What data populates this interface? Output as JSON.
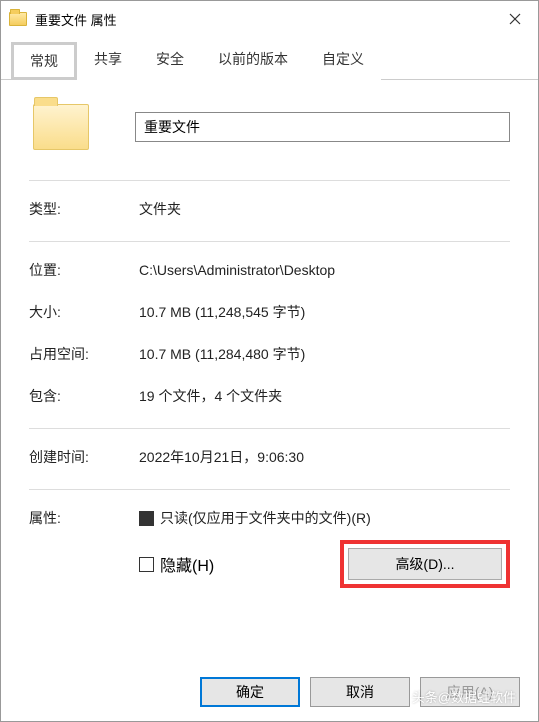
{
  "title": "重要文件 属性",
  "tabs": {
    "general": "常规",
    "sharing": "共享",
    "security": "安全",
    "previous": "以前的版本",
    "customize": "自定义"
  },
  "folder_name": "重要文件",
  "fields": {
    "type_label": "类型:",
    "type_value": "文件夹",
    "location_label": "位置:",
    "location_value": "C:\\Users\\Administrator\\Desktop",
    "size_label": "大小:",
    "size_value": "10.7 MB (11,248,545 字节)",
    "disk_label": "占用空间:",
    "disk_value": "10.7 MB (11,284,480 字节)",
    "contains_label": "包含:",
    "contains_value": "19 个文件，4 个文件夹",
    "created_label": "创建时间:",
    "created_value": "2022年10月21日，9:06:30",
    "attr_label": "属性:",
    "readonly_label": "只读(仅应用于文件夹中的文件)(R)",
    "hidden_label": "隐藏(H)",
    "advanced_btn": "高级(D)..."
  },
  "buttons": {
    "ok": "确定",
    "cancel": "取消",
    "apply": "应用(A)"
  },
  "watermark": "头条@数据蛙软件"
}
